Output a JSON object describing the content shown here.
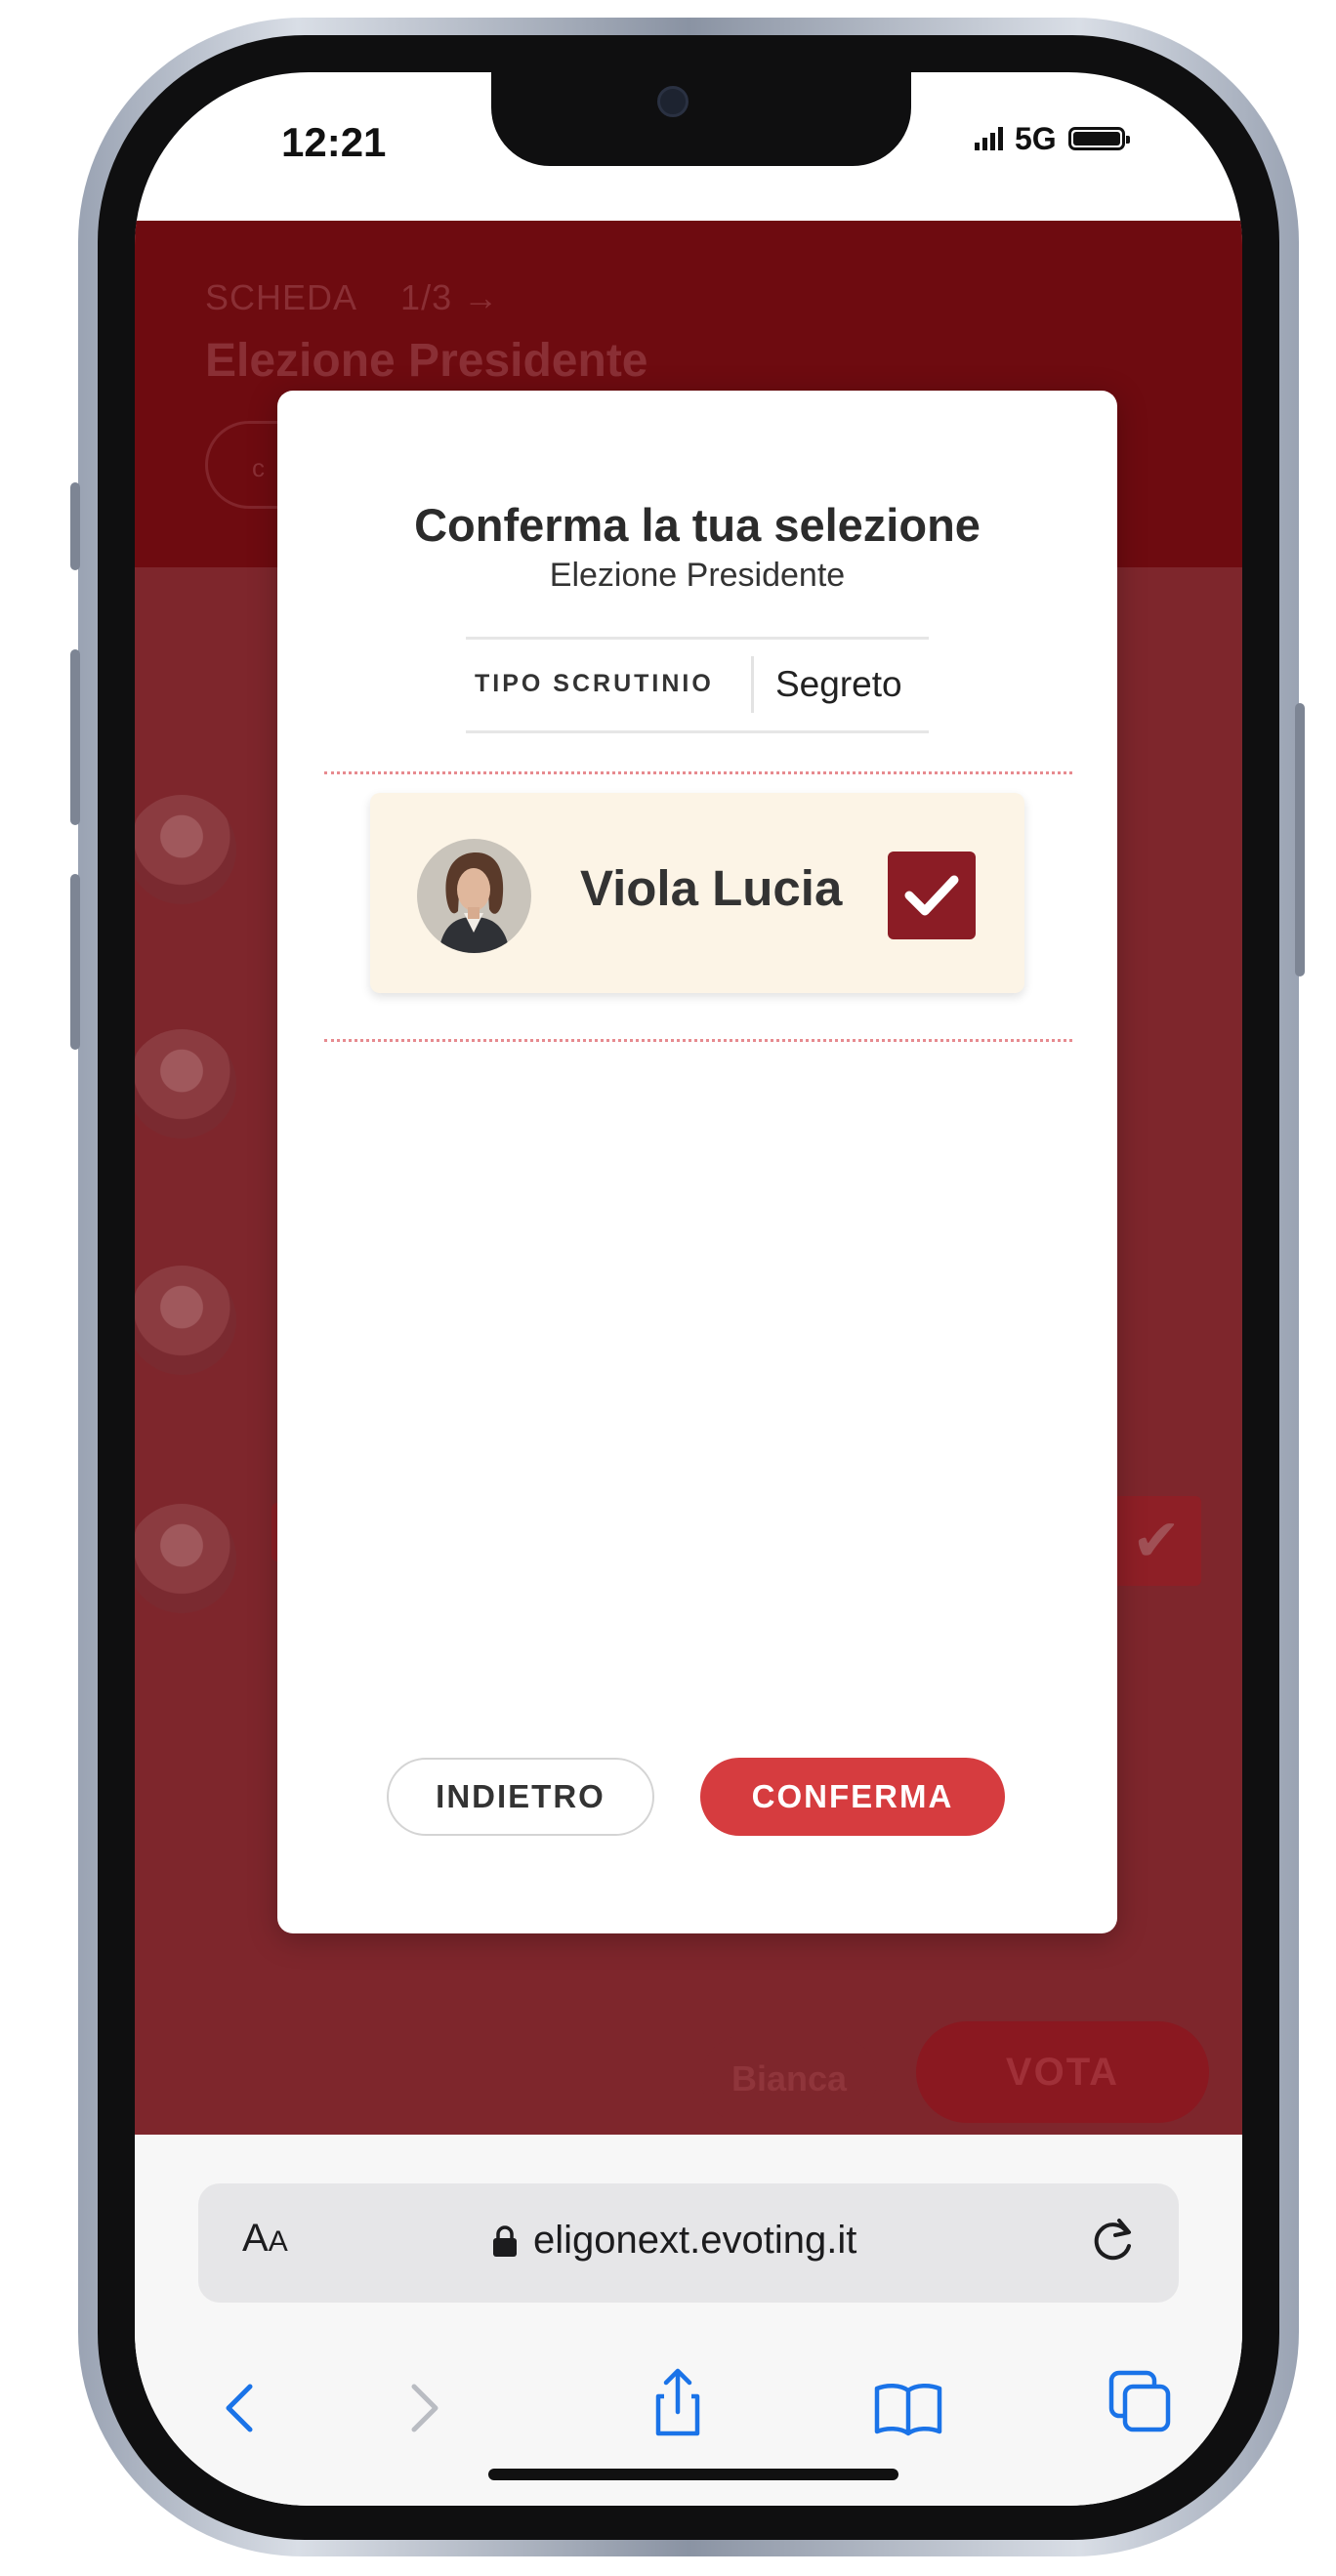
{
  "status_bar": {
    "time": "12:21",
    "network": "5G"
  },
  "app_header": {
    "kicker": "SCHEDA",
    "page": "1/3 →",
    "title": "Elezione Presidente",
    "pill_text": "c"
  },
  "background_actions": {
    "blank_label": "Bianca",
    "vote_label": "VOTA"
  },
  "modal": {
    "title": "Conferma la tua selezione",
    "subtitle": "Elezione Presidente",
    "tipo_label": "TIPO SCRUTINIO",
    "tipo_value": "Segreto",
    "candidate": {
      "name": "Viola Lucia",
      "selected": true
    },
    "back_label": "INDIETRO",
    "confirm_label": "CONFERMA"
  },
  "browser": {
    "aa_label_big": "A",
    "aa_label_small": "A",
    "url": "eligonext.evoting.it",
    "icons": [
      "back-icon",
      "forward-icon",
      "share-icon",
      "bookmarks-icon",
      "tabs-icon",
      "reload-icon",
      "lock-icon"
    ]
  },
  "colors": {
    "header_red": "#6e0b10",
    "overlay_red": "#7e262c",
    "check_red": "#8b1c25",
    "confirm_button": "#d63c3f",
    "card_bg": "#fcf4e6",
    "ios_blue": "#1a73e8"
  }
}
